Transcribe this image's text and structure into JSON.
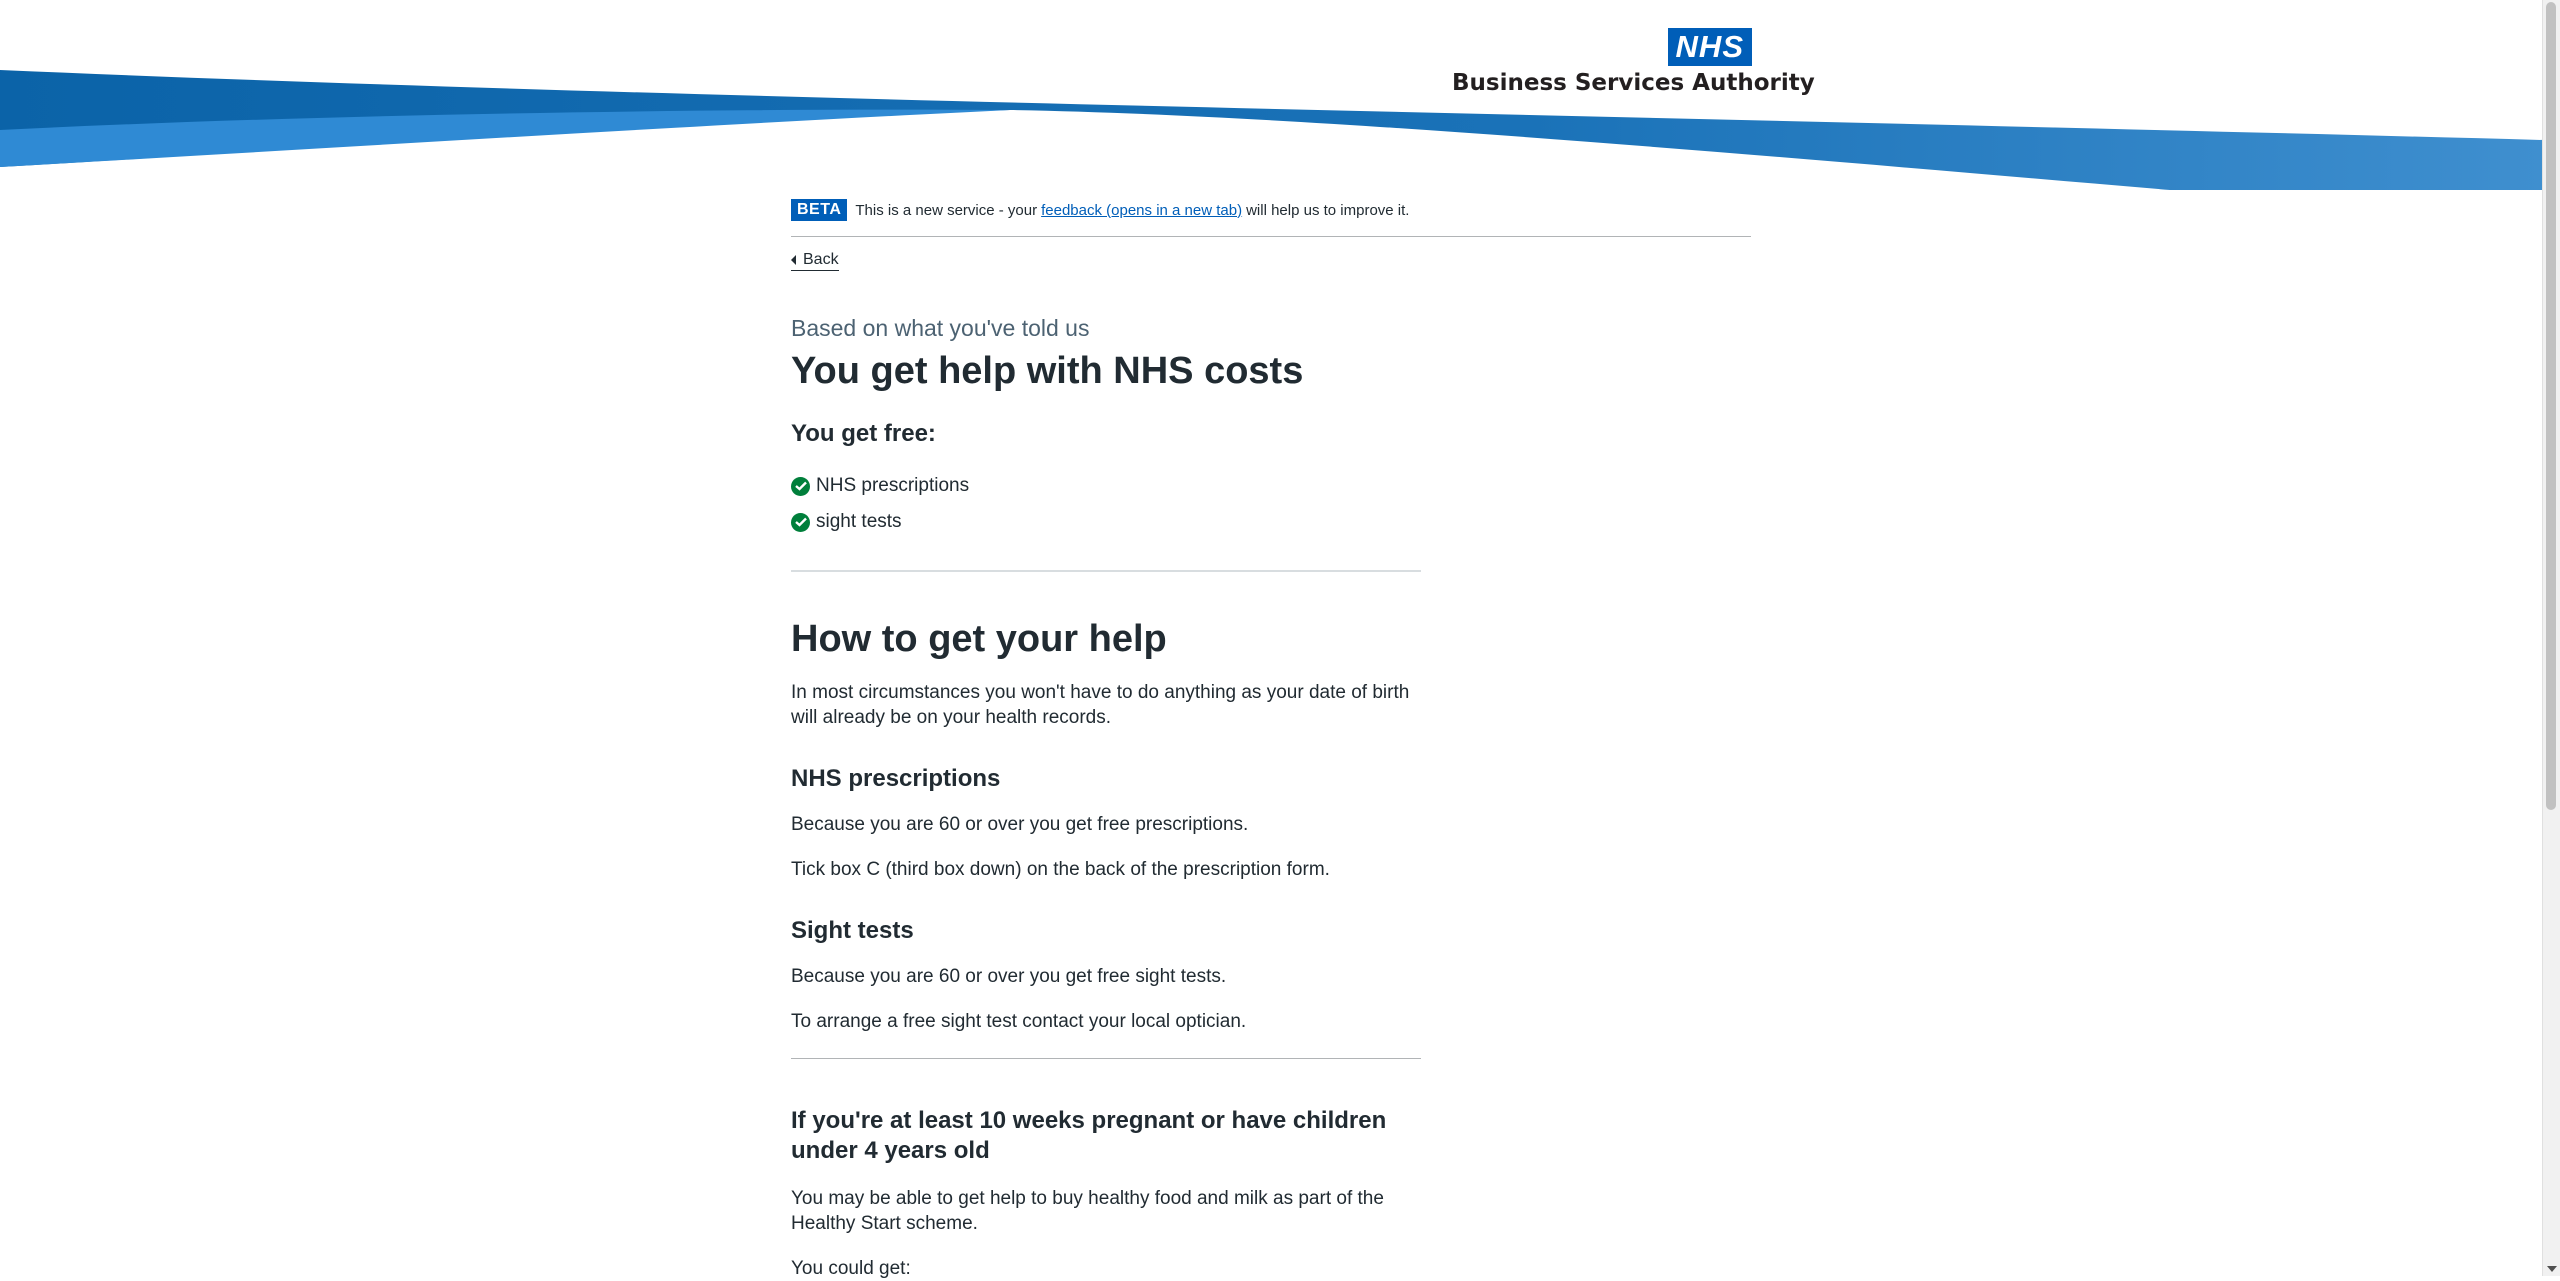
{
  "header": {
    "logo_nhs": "NHS",
    "logo_org": "Business Services Authority",
    "colors": {
      "dark_blue": "#005eb8",
      "light_blue": "#2d8fd9",
      "nhs_blue": "#005eb8"
    }
  },
  "beta_banner": {
    "tag": "BETA",
    "text_before": "This is a new service - your",
    "link": "feedback (opens in a new tab)",
    "text_after": "will help us to improve it."
  },
  "back_link": "Back",
  "caption": "Based on what you've told us",
  "title": "You get help with NHS costs",
  "free_heading": "You get free:",
  "free_items": [
    "NHS prescriptions",
    "sight tests"
  ],
  "how_heading": "How to get your help",
  "how_intro": "In most circumstances you won't have to do anything as your date of birth will already be on your health records.",
  "prescriptions": {
    "heading": "NHS prescriptions",
    "p1": "Because you are 60 or over you get free prescriptions.",
    "p2": "Tick box C (third box down) on the back of the prescription form."
  },
  "sight": {
    "heading": "Sight tests",
    "p1": "Because you are 60 or over you get free sight tests.",
    "p2": "To arrange a free sight test contact your local optician."
  },
  "pregnant": {
    "heading": "If you're at least 10 weeks pregnant or have children under 4 years old",
    "p1": "You may be able to get help to buy healthy food and milk as part of the Healthy Start scheme.",
    "p2": "You could get:"
  }
}
